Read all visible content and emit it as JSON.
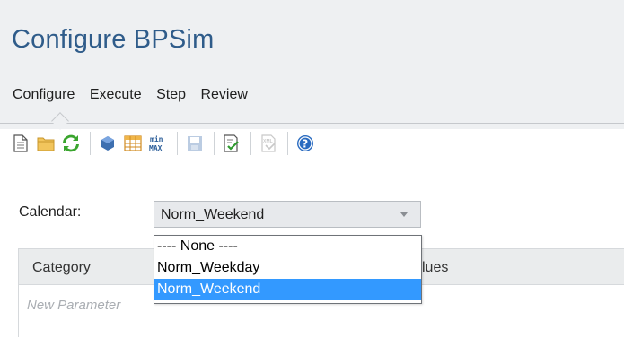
{
  "page": {
    "title": "Configure BPSim"
  },
  "tabs": [
    {
      "label": "Configure",
      "active": true
    },
    {
      "label": "Execute"
    },
    {
      "label": "Step"
    },
    {
      "label": "Review"
    }
  ],
  "toolbar": {
    "icons": [
      "new-document-icon",
      "open-folder-icon",
      "refresh-icon",
      "object-icon",
      "table-icon",
      "min-max-icon",
      "save-icon",
      "validate-icon",
      "export-xml-icon",
      "help-icon"
    ]
  },
  "calendar": {
    "label": "Calendar:",
    "selected": "Norm_Weekend",
    "options": [
      "---- None ----",
      "Norm_Weekday",
      "Norm_Weekend"
    ]
  },
  "grid": {
    "columns": [
      "Category",
      "lues"
    ],
    "placeholder_row": "New Parameter"
  },
  "colors": {
    "title": "#2f5c8a",
    "header_bg": "#eef0f2",
    "selection": "#3399ff"
  }
}
